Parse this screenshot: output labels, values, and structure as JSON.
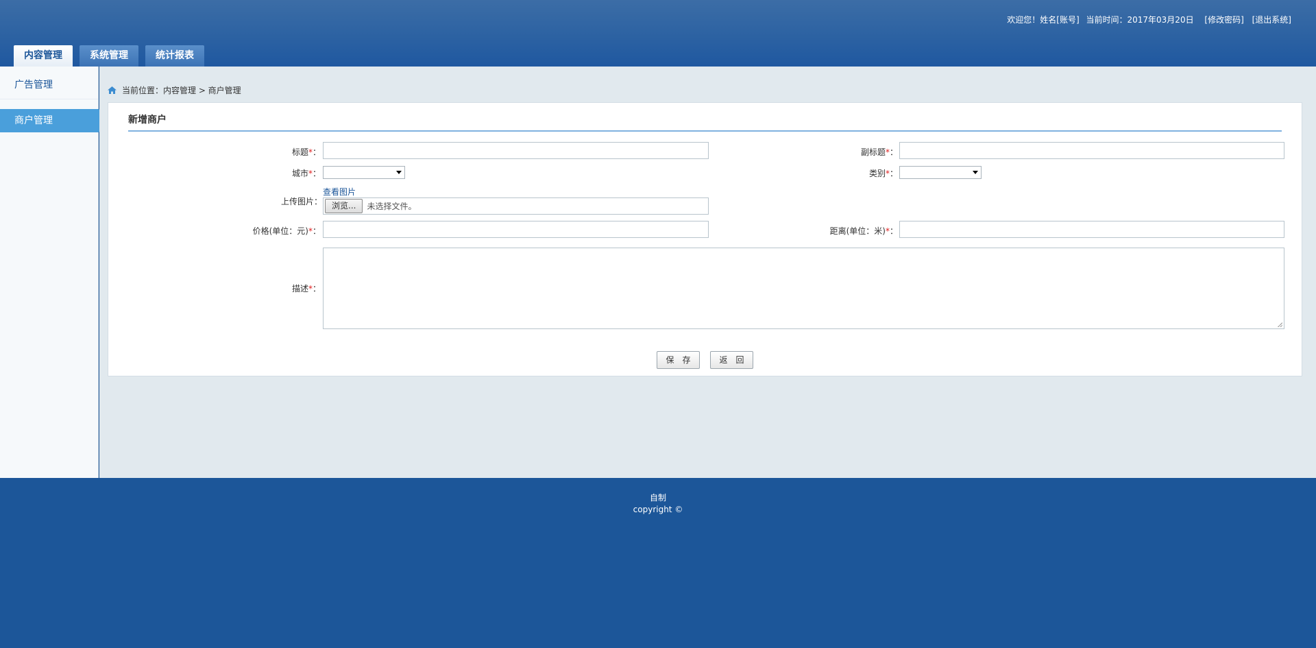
{
  "header": {
    "welcome": "欢迎您！姓名[账号]",
    "current_time": "当前时间：2017年03月20日",
    "change_password": "[修改密码]",
    "logout": "[退出系统]"
  },
  "nav": {
    "tabs": [
      {
        "label": "内容管理",
        "active": true
      },
      {
        "label": "系统管理",
        "active": false
      },
      {
        "label": "统计报表",
        "active": false
      }
    ]
  },
  "sidebar": {
    "items": [
      {
        "label": "广告管理",
        "active": false
      },
      {
        "label": "商户管理",
        "active": true
      }
    ]
  },
  "breadcrumb": {
    "text": "当前位置：内容管理 > 商户管理"
  },
  "form": {
    "title": "新增商户",
    "required_mark": "*",
    "colon": "：",
    "fields": {
      "title_label": "标题",
      "subtitle_label": "副标题",
      "city_label": "城市",
      "category_label": "类别",
      "upload_label": "上传图片：",
      "view_image": "查看图片",
      "browse_button": "浏览...",
      "file_status": "未选择文件。",
      "price_label": "价格(单位：元)",
      "distance_label": "距离(单位：米)",
      "description_label": "描述"
    },
    "buttons": {
      "save": "保　存",
      "back": "返　回"
    }
  },
  "footer": {
    "line1": "自制",
    "line2": "copyright ©"
  },
  "colors": {
    "header_blue": "#2f64a3",
    "footer_blue": "#1c5699",
    "sidebar_active": "#4a9fdb",
    "required_red": "#e02020"
  }
}
